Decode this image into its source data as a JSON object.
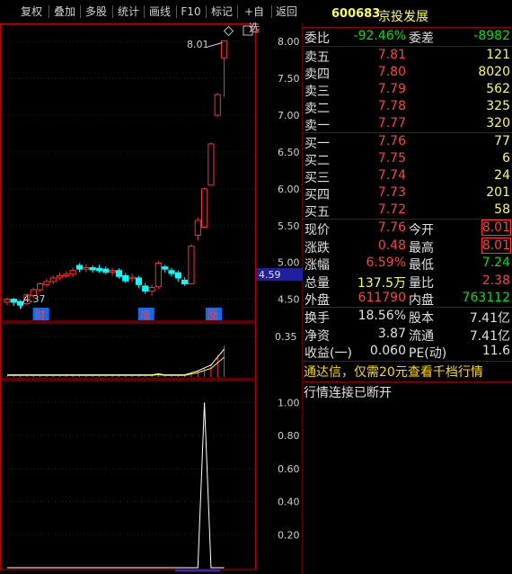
{
  "toolbar": {
    "buttons": [
      "复权",
      "叠加",
      "多股",
      "统计",
      "画线",
      "F10",
      "标记",
      "+自选",
      "返回"
    ]
  },
  "chart": {
    "price_high_label": "8.01",
    "price_low_label": "4.37",
    "current_price_tag": "4.59",
    "price_axis": [
      "8.00",
      "7.50",
      "7.00",
      "6.50",
      "6.00",
      "5.50",
      "5.00",
      "4.50"
    ],
    "event_markers": [
      "财",
      "增",
      "涨"
    ],
    "vol_axis": [
      "0.35"
    ],
    "sub_axis": [
      "1.00",
      "0.80",
      "0.60",
      "0.40",
      "0.20"
    ],
    "colors": {
      "up": "#ff3030",
      "down": "#00ffff",
      "ma": "#ffff00",
      "frame": "#c00000"
    }
  },
  "chart_data": {
    "type": "candlestick",
    "title": "",
    "ylim": [
      4.3,
      8.1
    ],
    "note_levels": {
      "high": 8.01,
      "low": 4.37
    },
    "candles": [
      {
        "o": 4.46,
        "c": 4.5,
        "h": 4.52,
        "l": 4.42
      },
      {
        "o": 4.5,
        "c": 4.46,
        "h": 4.52,
        "l": 4.41
      },
      {
        "o": 4.47,
        "c": 4.42,
        "h": 4.49,
        "l": 4.37
      },
      {
        "o": 4.44,
        "c": 4.56,
        "h": 4.58,
        "l": 4.42
      },
      {
        "o": 4.55,
        "c": 4.63,
        "h": 4.66,
        "l": 4.52
      },
      {
        "o": 4.63,
        "c": 4.71,
        "h": 4.73,
        "l": 4.6
      },
      {
        "o": 4.7,
        "c": 4.74,
        "h": 4.78,
        "l": 4.67
      },
      {
        "o": 4.74,
        "c": 4.79,
        "h": 4.82,
        "l": 4.71
      },
      {
        "o": 4.79,
        "c": 4.82,
        "h": 4.86,
        "l": 4.76
      },
      {
        "o": 4.82,
        "c": 4.84,
        "h": 4.88,
        "l": 4.79
      },
      {
        "o": 4.84,
        "c": 4.89,
        "h": 4.93,
        "l": 4.8
      },
      {
        "o": 4.96,
        "c": 4.91,
        "h": 4.99,
        "l": 4.87
      },
      {
        "o": 4.91,
        "c": 4.93,
        "h": 4.98,
        "l": 4.87
      },
      {
        "o": 4.93,
        "c": 4.9,
        "h": 4.96,
        "l": 4.86
      },
      {
        "o": 4.92,
        "c": 4.89,
        "h": 4.97,
        "l": 4.86
      },
      {
        "o": 4.91,
        "c": 4.87,
        "h": 4.95,
        "l": 4.84
      },
      {
        "o": 4.87,
        "c": 4.89,
        "h": 4.93,
        "l": 4.82
      },
      {
        "o": 4.89,
        "c": 4.81,
        "h": 4.92,
        "l": 4.78
      },
      {
        "o": 4.82,
        "c": 4.75,
        "h": 4.86,
        "l": 4.72
      },
      {
        "o": 4.78,
        "c": 4.8,
        "h": 4.85,
        "l": 4.74
      },
      {
        "o": 4.79,
        "c": 4.7,
        "h": 4.82,
        "l": 4.65
      },
      {
        "o": 4.68,
        "c": 4.61,
        "h": 4.72,
        "l": 4.57
      },
      {
        "o": 4.61,
        "c": 4.66,
        "h": 4.7,
        "l": 4.55
      },
      {
        "o": 4.67,
        "c": 4.99,
        "h": 5.02,
        "l": 4.64
      },
      {
        "o": 4.94,
        "c": 4.91,
        "h": 4.97,
        "l": 4.86
      },
      {
        "o": 4.89,
        "c": 4.85,
        "h": 4.93,
        "l": 4.81
      },
      {
        "o": 4.86,
        "c": 4.79,
        "h": 4.89,
        "l": 4.74
      },
      {
        "o": 4.76,
        "c": 4.71,
        "h": 4.8,
        "l": 4.68
      },
      {
        "o": 4.71,
        "c": 5.22,
        "h": 5.25,
        "l": 4.7
      },
      {
        "o": 5.37,
        "c": 5.57,
        "h": 5.61,
        "l": 5.3
      },
      {
        "o": 5.48,
        "c": 6.0,
        "h": 6.02,
        "l": 5.47
      },
      {
        "o": 6.05,
        "c": 6.61,
        "h": 6.63,
        "l": 6.04
      },
      {
        "o": 7.0,
        "c": 7.28,
        "h": 7.3,
        "l": 6.98
      },
      {
        "o": 7.78,
        "c": 8.01,
        "h": 8.01,
        "l": 7.25
      }
    ],
    "volume_panel_ylim": [
      0,
      0.45
    ],
    "volume": [
      0.01,
      0.01,
      0.01,
      0.01,
      0.01,
      0.01,
      0.01,
      0.01,
      0.01,
      0.01,
      0.01,
      0.01,
      0.01,
      0.01,
      0.01,
      0.01,
      0.01,
      0.01,
      0.01,
      0.01,
      0.01,
      0.01,
      0.01,
      0.02,
      0.01,
      0.01,
      0.01,
      0.01,
      0.03,
      0.05,
      0.08,
      0.11,
      0.19,
      0.27
    ],
    "sub_panel_ylim": [
      0,
      1.1
    ],
    "sub_series": [
      0,
      0,
      0,
      0,
      0,
      0,
      0,
      0,
      0,
      0,
      0,
      0,
      0,
      0,
      0,
      0,
      0,
      0,
      0,
      0,
      0,
      0,
      0,
      0,
      0,
      0,
      0,
      0,
      0,
      0,
      1.0,
      0,
      0,
      0
    ]
  },
  "quote": {
    "code": "600683",
    "name": "京投发展",
    "weibi_label": "委比",
    "weibi_value": "-92.46%",
    "weicha_label": "委差",
    "weicha_value": "-8982",
    "asks": [
      {
        "label": "卖五",
        "price": "7.81",
        "vol": "121"
      },
      {
        "label": "卖四",
        "price": "7.80",
        "vol": "8020"
      },
      {
        "label": "卖三",
        "price": "7.79",
        "vol": "562"
      },
      {
        "label": "卖二",
        "price": "7.78",
        "vol": "325"
      },
      {
        "label": "卖一",
        "price": "7.77",
        "vol": "320"
      }
    ],
    "bids": [
      {
        "label": "买一",
        "price": "7.76",
        "vol": "77"
      },
      {
        "label": "买二",
        "price": "7.75",
        "vol": "6"
      },
      {
        "label": "买三",
        "price": "7.74",
        "vol": "24"
      },
      {
        "label": "买四",
        "price": "7.73",
        "vol": "201"
      },
      {
        "label": "买五",
        "price": "7.72",
        "vol": "58"
      }
    ],
    "stats": [
      {
        "l1": "现价",
        "v1": "7.76",
        "l2": "今开",
        "v2": "8.01"
      },
      {
        "l1": "涨跌",
        "v1": "0.48",
        "l2": "最高",
        "v2": "8.01"
      },
      {
        "l1": "涨幅",
        "v1": "6.59%",
        "l2": "最低",
        "v2": "7.24"
      },
      {
        "l1": "总量",
        "v1": "137.5万",
        "l2": "量比",
        "v2": "2.38"
      },
      {
        "l1": "外盘",
        "v1": "611790",
        "l2": "内盘",
        "v2": "763112"
      }
    ],
    "fin": [
      {
        "l1": "换手",
        "v1": "18.56%",
        "l2": "股本",
        "v2": "7.41亿"
      },
      {
        "l1": "净资",
        "v1": "3.87",
        "l2": "流通",
        "v2": "7.41亿"
      },
      {
        "l1": "收益(一)",
        "v1": "0.060",
        "l2": "PE(动)",
        "v2": "11.6"
      }
    ],
    "ad_text": "通达信，仅需20元查看千档行情",
    "status_text": "行情连接已断开"
  }
}
